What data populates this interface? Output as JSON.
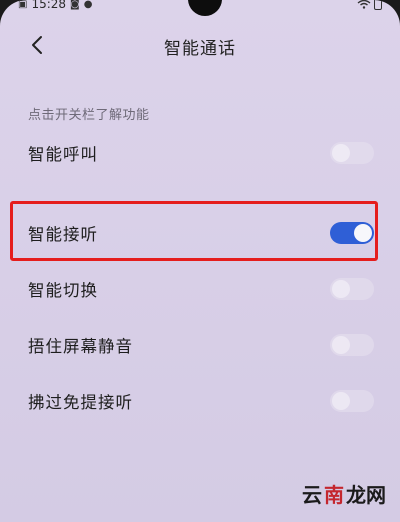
{
  "status_bar": {
    "time": "15:28"
  },
  "header": {
    "title": "智能通话"
  },
  "section": {
    "hint": "点击开关栏了解功能"
  },
  "settings": [
    {
      "label": "智能呼叫",
      "enabled": false
    },
    {
      "label": "智能接听",
      "enabled": true
    },
    {
      "label": "智能切换",
      "enabled": false
    },
    {
      "label": "捂住屏幕静音",
      "enabled": false
    },
    {
      "label": "拂过免提接听",
      "enabled": false
    }
  ],
  "watermark": {
    "part1": "云",
    "part2": "南",
    "part3": "龙网"
  },
  "colors": {
    "toggle_on": "#2f5fd6",
    "highlight": "#e51d1d"
  }
}
